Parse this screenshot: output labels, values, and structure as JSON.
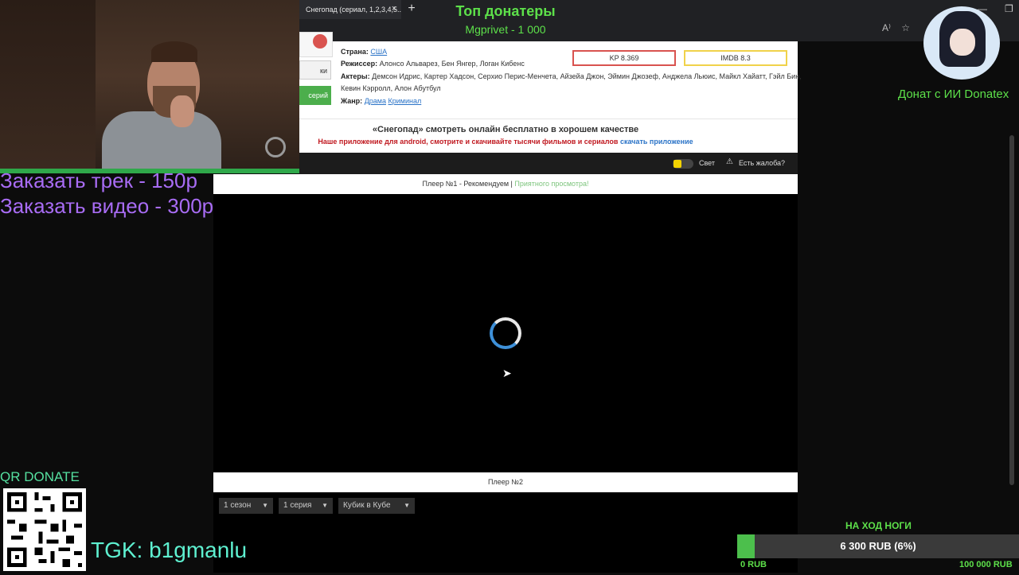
{
  "browser": {
    "tab_title": "Снегопад (сериал, 1,2,3,4,5...",
    "close_symbol": "×",
    "new_tab_symbol": "+"
  },
  "overlay_top": {
    "title": "Топ донатеры",
    "top_donor": "Mgprivet - 1 000"
  },
  "overlay_left": {
    "order_track": "Заказать трек - 150р",
    "order_video": "Заказать видео - 300р",
    "qr_label": "QR DONATE",
    "tgk": "TGK: b1gmanlu"
  },
  "overlay_right": {
    "ai_donate": "Донат с ИИ Donatex",
    "goal_title": "НА ХОД НОГИ",
    "goal_text": "6 300 RUB (6%)",
    "goal_progress_percent": 6,
    "goal_min": "0 RUB",
    "goal_max": "100 000 RUB",
    "goal_color": "#4cbf4c"
  },
  "site": {
    "btn_trailer": "ки",
    "btn_series": "серий",
    "country_label": "Страна:",
    "country": "США",
    "director_label": "Режиссер:",
    "director": "Алонсо Альварез, Бен Янгер, Логан Кибенс",
    "actors_label": "Актеры:",
    "actors_line1": "Демсон Идрис, Картер Хадсон, Серхио Перис-Менчета, Айзейа Джон, Эймин Джозеф, Анджела Льюис, Майкл Хайатт, Гэйл Бин,",
    "actors_line2": "Кевин Кэрролл, Алон Абутбул",
    "genre_label": "Жанр:",
    "genre1": "Драма",
    "genre2": "Криминал",
    "rating_kp": "KP 8.369",
    "rating_imdb": "IMDB 8.3",
    "watch_title": "«Снегопад» смотреть онлайн бесплатно в хорошем качестве",
    "app_line": "Наше приложение для android, смотрите и скачивайте тысячи фильмов и сериалов",
    "app_link": "скачать приложение"
  },
  "toolbar": {
    "light_label": "Свет",
    "complaint": "Есть жалоба?"
  },
  "player1": {
    "header_main": "Плеер №1 - Рекомендуем |",
    "header_green": "Приятного просмотра!"
  },
  "player2": {
    "header": "Плеер №2",
    "season": "1 сезон",
    "episode": "1 серия",
    "voice": "Кубик в Кубе",
    "arrow": "▼"
  }
}
